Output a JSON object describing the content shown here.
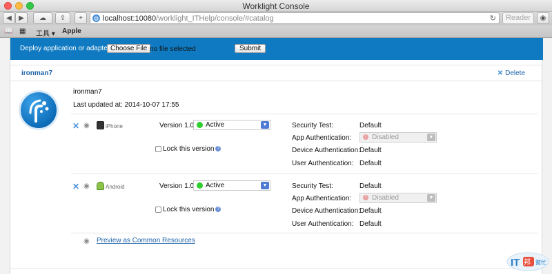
{
  "window": {
    "title": "Worklight Console"
  },
  "toolbar": {
    "url_host": "localhost:10080",
    "url_path": "/worklight_ITHelp/console/#catalog",
    "reader_label": "Reader"
  },
  "bookmarks": {
    "items": [
      "工具 ▾",
      "Apple"
    ]
  },
  "deploy": {
    "label": "Deploy application or adapter:",
    "choose_file_label": "Choose File",
    "file_status": "no file selected",
    "submit_label": "Submit"
  },
  "app": {
    "header_name": "ironman7",
    "delete_label": "Delete",
    "title": "ironman7",
    "last_updated": "Last updated at: 2014-10-07 17:55",
    "preview_label": "Preview as Common Resources"
  },
  "environments": [
    {
      "name": "iPhone",
      "version_label": "Version 1.0",
      "status": "Active",
      "lock_label": "Lock this version",
      "security": [
        {
          "label": "Security Test:",
          "value": "Default"
        },
        {
          "label": "App Authentication:",
          "value": "Disabled"
        },
        {
          "label": "Device Authentication:",
          "value": "Default"
        },
        {
          "label": "User Authentication:",
          "value": "Default"
        }
      ]
    },
    {
      "name": "Android",
      "version_label": "Version 1.0",
      "status": "Active",
      "lock_label": "Lock this version",
      "security": [
        {
          "label": "Security Test:",
          "value": "Default"
        },
        {
          "label": "App Authentication:",
          "value": "Disabled"
        },
        {
          "label": "Device Authentication:",
          "value": "Default"
        },
        {
          "label": "User Authentication:",
          "value": "Default"
        }
      ]
    }
  ],
  "watermark": {
    "text": "IT邦幫忙"
  },
  "colors": {
    "deploy_bar": "#0f7ac1",
    "link": "#1d63a8",
    "active_dot": "#2fcf2f"
  }
}
